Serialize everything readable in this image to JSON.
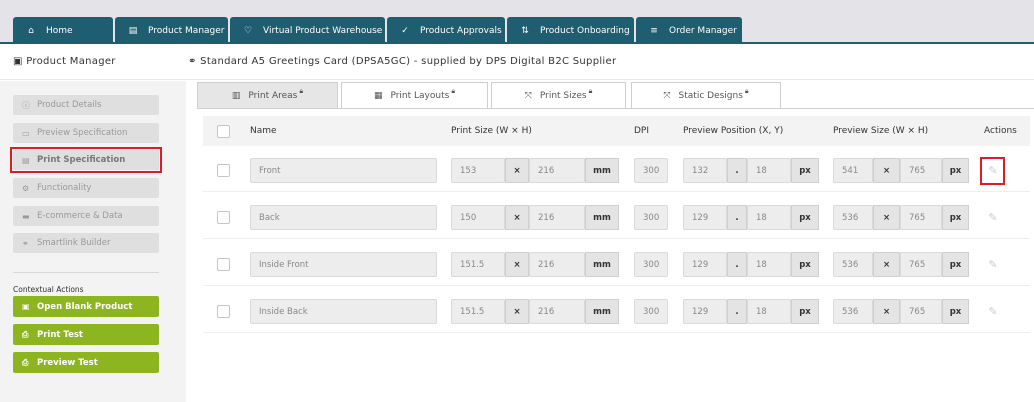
{
  "nav": {
    "tabs": [
      {
        "label": "Home",
        "icon": "home-icon"
      },
      {
        "label": "Product Manager",
        "icon": "document-icon"
      },
      {
        "label": "Virtual Product Warehouse",
        "icon": "heart-icon"
      },
      {
        "label": "Product Approvals",
        "icon": "thumbs-up-icon"
      },
      {
        "label": "Product Onboarding",
        "icon": "plug-icon"
      },
      {
        "label": "Order Manager",
        "icon": "list-icon"
      }
    ]
  },
  "header": {
    "section_title": "Product Manager",
    "breadcrumb": "Standard A5 Greetings Card (DPSA5GC) - supplied by DPS Digital B2C Supplier"
  },
  "sidebar": {
    "items": [
      {
        "label": "Product Details",
        "icon": "info-icon"
      },
      {
        "label": "Preview Specification",
        "icon": "monitor-icon"
      },
      {
        "label": "Print Specification",
        "icon": "file-icon",
        "active": true
      },
      {
        "label": "Functionality",
        "icon": "cogs-icon"
      },
      {
        "label": "E-commerce & Data",
        "icon": "credit-card-icon"
      },
      {
        "label": "Smartlink Builder",
        "icon": "link-icon"
      }
    ],
    "contextual_label": "Contextual Actions",
    "actions": [
      {
        "label": "Open Blank Product",
        "icon": "file-icon"
      },
      {
        "label": "Print Test",
        "icon": "printer-icon"
      },
      {
        "label": "Preview Test",
        "icon": "printer-icon"
      }
    ]
  },
  "subtabs": [
    {
      "label": "Print Areas",
      "icon": "map-icon",
      "active": true
    },
    {
      "label": "Print Layouts",
      "icon": "table-icon"
    },
    {
      "label": "Print Sizes",
      "icon": "expand-icon"
    },
    {
      "label": "Static Designs",
      "icon": "expand-icon"
    }
  ],
  "table": {
    "headers": {
      "name": "Name",
      "print_size": "Print Size (W × H)",
      "dpi": "DPI",
      "preview_position": "Preview Position (X, Y)",
      "preview_size": "Preview Size (W × H)",
      "actions": "Actions"
    },
    "units": {
      "mm": "mm",
      "px": "px",
      "times": "×",
      "dot": "."
    },
    "rows": [
      {
        "name": "Front",
        "pw": "153",
        "ph": "216",
        "dpi": "300",
        "px": "132",
        "py": "18",
        "sw": "541",
        "sh": "765"
      },
      {
        "name": "Back",
        "pw": "150",
        "ph": "216",
        "dpi": "300",
        "px": "129",
        "py": "18",
        "sw": "536",
        "sh": "765"
      },
      {
        "name": "Inside Front",
        "pw": "151.5",
        "ph": "216",
        "dpi": "300",
        "px": "129",
        "py": "18",
        "sw": "536",
        "sh": "765"
      },
      {
        "name": "Inside Back",
        "pw": "151.5",
        "ph": "216",
        "dpi": "300",
        "px": "129",
        "py": "18",
        "sw": "536",
        "sh": "765"
      }
    ]
  },
  "colors": {
    "nav": "#1e5e70",
    "accent_green": "#8db51f",
    "highlight": "#e01b24"
  }
}
